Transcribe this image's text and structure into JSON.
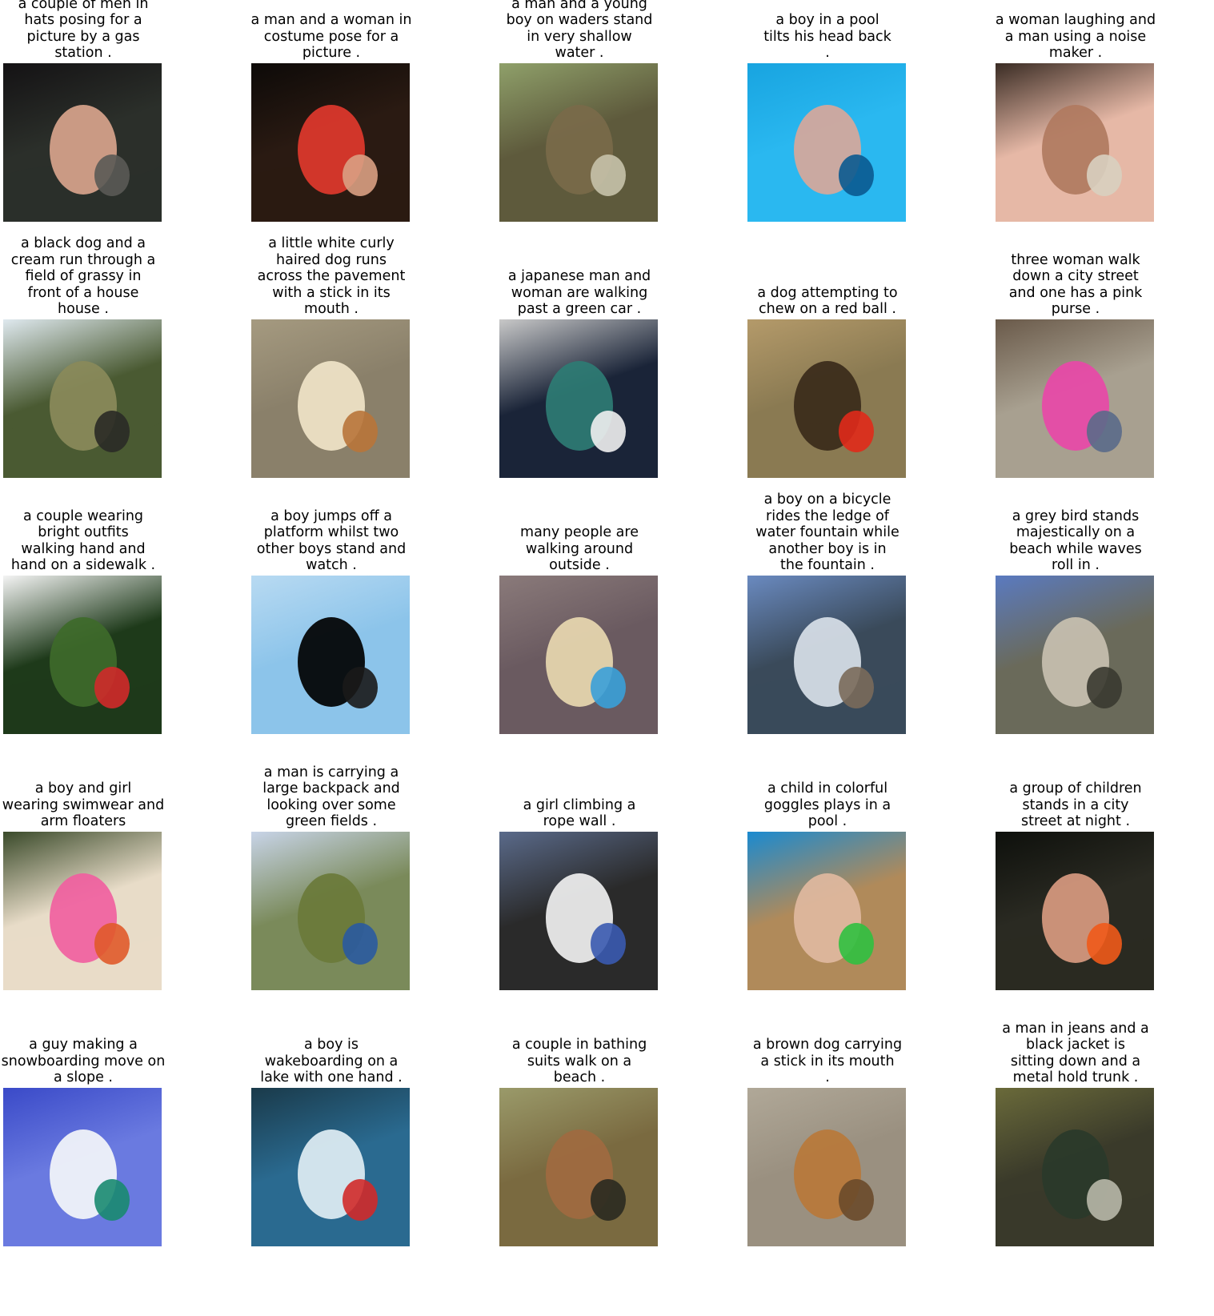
{
  "items": [
    {
      "caption": [
        "a couple of men in",
        "hats posing for a",
        "picture by a gas",
        "station ."
      ],
      "palette": [
        "#141214",
        "#2b2f2a",
        "#d8a48c",
        "#5a5a55"
      ]
    },
    {
      "caption": [
        "a man and a woman in",
        "costume pose for a",
        "picture ."
      ],
      "palette": [
        "#0d0a08",
        "#2a1a12",
        "#e0382c",
        "#d9a083"
      ]
    },
    {
      "caption": [
        "a man and a young",
        "boy on waders stand",
        "in very shallow",
        "water ."
      ],
      "palette": [
        "#8fa06a",
        "#5e5a3c",
        "#7a6a4a",
        "#c7c2aa"
      ]
    },
    {
      "caption": [
        "a boy in a pool",
        "tilts his head back",
        "."
      ],
      "palette": [
        "#18a4e0",
        "#2ab8f0",
        "#d8a79a",
        "#0a5a90"
      ]
    },
    {
      "caption": [
        "a woman laughing and",
        "a man using a noise",
        "maker ."
      ],
      "palette": [
        "#3a2c24",
        "#e6b8a6",
        "#b07a60",
        "#d8d0c0"
      ]
    },
    {
      "caption": [
        "a black dog and a",
        "cream run through a",
        "field of grassy in",
        "front of a house",
        "house ."
      ],
      "palette": [
        "#dfe9ef",
        "#4a5a32",
        "#8a8a5a",
        "#2a2a26"
      ]
    },
    {
      "caption": [
        "a little white curly",
        "haired dog runs",
        "across the pavement",
        "with a stick in its",
        "mouth ."
      ],
      "palette": [
        "#a59a80",
        "#8a806a",
        "#f0e4c8",
        "#b8743a"
      ]
    },
    {
      "caption": [
        "a japanese man and",
        "woman are walking",
        "past a green car ."
      ],
      "palette": [
        "#c8c8c8",
        "#1a2438",
        "#2e7c74",
        "#f0f0f0"
      ]
    },
    {
      "caption": [
        "a dog attempting to",
        "chew on a red ball ."
      ],
      "palette": [
        "#b49a6a",
        "#8a7a52",
        "#3a2a1a",
        "#e02a1a"
      ]
    },
    {
      "caption": [
        "three woman walk",
        "down a city street",
        "and one has a pink",
        "purse ."
      ],
      "palette": [
        "#6a5a4a",
        "#a8a090",
        "#e848a8",
        "#5a6a8a"
      ]
    },
    {
      "caption": [
        "a couple wearing",
        "bright outfits",
        "walking hand and",
        "hand on a sidewalk ."
      ],
      "palette": [
        "#f4f4f4",
        "#1e3a1a",
        "#3e6a2a",
        "#d02a2a"
      ]
    },
    {
      "caption": [
        "a boy jumps off a",
        "platform whilst two",
        "other boys stand and",
        "watch ."
      ],
      "palette": [
        "#b8daf2",
        "#8cc4ea",
        "#000000",
        "#1a1a1a"
      ]
    },
    {
      "caption": [
        "many people are",
        "walking around",
        "outside ."
      ],
      "palette": [
        "#8a7a7a",
        "#6a5a60",
        "#e8d8b0",
        "#3aa0d8"
      ]
    },
    {
      "caption": [
        "a boy on a bicycle",
        "rides the ledge of",
        "water fountain while",
        "another boy is in",
        "the fountain ."
      ],
      "palette": [
        "#6a8ac0",
        "#3a4a5a",
        "#d8e0e8",
        "#7a6a5a"
      ]
    },
    {
      "caption": [
        "a grey bird stands",
        "majestically on a",
        "beach while waves",
        "roll in ."
      ],
      "palette": [
        "#5a7ac0",
        "#6a6a5a",
        "#c8c0b0",
        "#3a3a30"
      ]
    },
    {
      "caption": [
        "a boy and girl",
        "wearing swimwear and",
        "arm floaters"
      ],
      "palette": [
        "#3a4a2a",
        "#e8dcc8",
        "#f060a0",
        "#e05a2a"
      ]
    },
    {
      "caption": [
        "a man is carrying a",
        "large backpack and",
        "looking over some",
        "green fields ."
      ],
      "palette": [
        "#c8d4e8",
        "#7a8a5a",
        "#6a7a3a",
        "#2a5aa0"
      ]
    },
    {
      "caption": [
        "a girl climbing a",
        "rope wall ."
      ],
      "palette": [
        "#5a6a8a",
        "#2a2a2a",
        "#f0f0f0",
        "#3a5ab0"
      ]
    },
    {
      "caption": [
        "a child in colorful",
        "goggles plays in a",
        "pool ."
      ],
      "palette": [
        "#1a8ad0",
        "#b08a5a",
        "#e0b8a0",
        "#30c040"
      ]
    },
    {
      "caption": [
        "a group of children",
        "stands in a city",
        "street at night ."
      ],
      "palette": [
        "#0e100c",
        "#2a2a22",
        "#d89a80",
        "#f05a1a"
      ]
    },
    {
      "caption": [
        "a guy making a",
        "snowboarding move on",
        "a slope ."
      ],
      "palette": [
        "#3a4ac8",
        "#6a7ae0",
        "#f4f6fa",
        "#1a8a70"
      ]
    },
    {
      "caption": [
        "a boy is",
        "wakeboarding on a",
        "lake with one hand ."
      ],
      "palette": [
        "#1a3a4a",
        "#2a6a90",
        "#e0eef4",
        "#d02a2a"
      ]
    },
    {
      "caption": [
        "a couple in bathing",
        "suits walk on a",
        "beach ."
      ],
      "palette": [
        "#9a9a6a",
        "#7a6a40",
        "#a06a40",
        "#2a2a20"
      ]
    },
    {
      "caption": [
        "a brown dog carrying",
        "a stick in its mouth",
        "."
      ],
      "palette": [
        "#b0a898",
        "#9a9080",
        "#b8783a",
        "#6a4a2a"
      ]
    },
    {
      "caption": [
        "a man in jeans and a",
        "black jacket is",
        "sitting down and a",
        "metal hold trunk ."
      ],
      "palette": [
        "#6a6a3a",
        "#3a3a2a",
        "#2a3a2a",
        "#b8b8a8"
      ]
    }
  ]
}
